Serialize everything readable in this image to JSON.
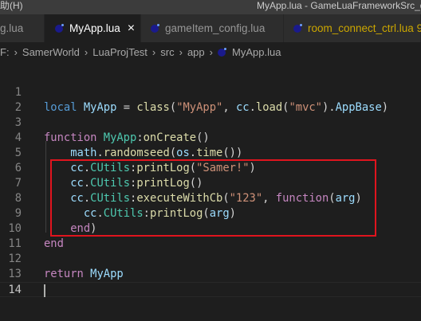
{
  "titlebar": {
    "menu": "助(H)",
    "title": "MyApp.lua - GameLuaFrameworkSrc_q"
  },
  "tabs": [
    {
      "label": "g.lua"
    },
    {
      "label": "MyApp.lua",
      "close": "×"
    },
    {
      "label": "gameItem_config.lua"
    },
    {
      "label": "room_connect_ctrl.lua",
      "badge": "9"
    }
  ],
  "breadcrumb": [
    "F:",
    "SamerWorld",
    "LuaProjTest",
    "src",
    "app",
    "MyApp.lua"
  ],
  "colors": {
    "highlight_box": "#e0141e",
    "keyword": "#569cd6",
    "string": "#ce9178"
  },
  "code": {
    "line_numbers": [
      "1",
      "2",
      "3",
      "4",
      "5",
      "6",
      "7",
      "8",
      "9",
      "10",
      "11",
      "12",
      "13",
      "14"
    ],
    "l2": [
      "local",
      " ",
      "MyApp",
      " = ",
      "class",
      "(",
      "\"MyApp\"",
      ", ",
      "cc",
      ".",
      "load",
      "(",
      "\"mvc\"",
      ").",
      "AppBase",
      ")"
    ],
    "l4": [
      "function",
      " ",
      "MyApp",
      ":",
      "onCreate",
      "()"
    ],
    "l5": [
      "    ",
      "math",
      ".",
      "randomseed",
      "(",
      "os",
      ".",
      "time",
      "())"
    ],
    "l6": [
      "    ",
      "cc",
      ".",
      "CUtils",
      ":",
      "printLog",
      "(",
      "\"Samer!\"",
      ")"
    ],
    "l7": [
      "    ",
      "cc",
      ".",
      "CUtils",
      ":",
      "printLog",
      "()"
    ],
    "l8": [
      "    ",
      "cc",
      ".",
      "CUtils",
      ":",
      "executeWithCb",
      "(",
      "\"123\"",
      ", ",
      "function",
      "(",
      "arg",
      ")"
    ],
    "l9": [
      "      ",
      "cc",
      ".",
      "CUtils",
      ":",
      "printLog",
      "(",
      "arg",
      ")"
    ],
    "l10": [
      "    ",
      "end",
      ")"
    ],
    "l11": [
      "end"
    ],
    "l13": [
      "return",
      " ",
      "MyApp"
    ]
  }
}
